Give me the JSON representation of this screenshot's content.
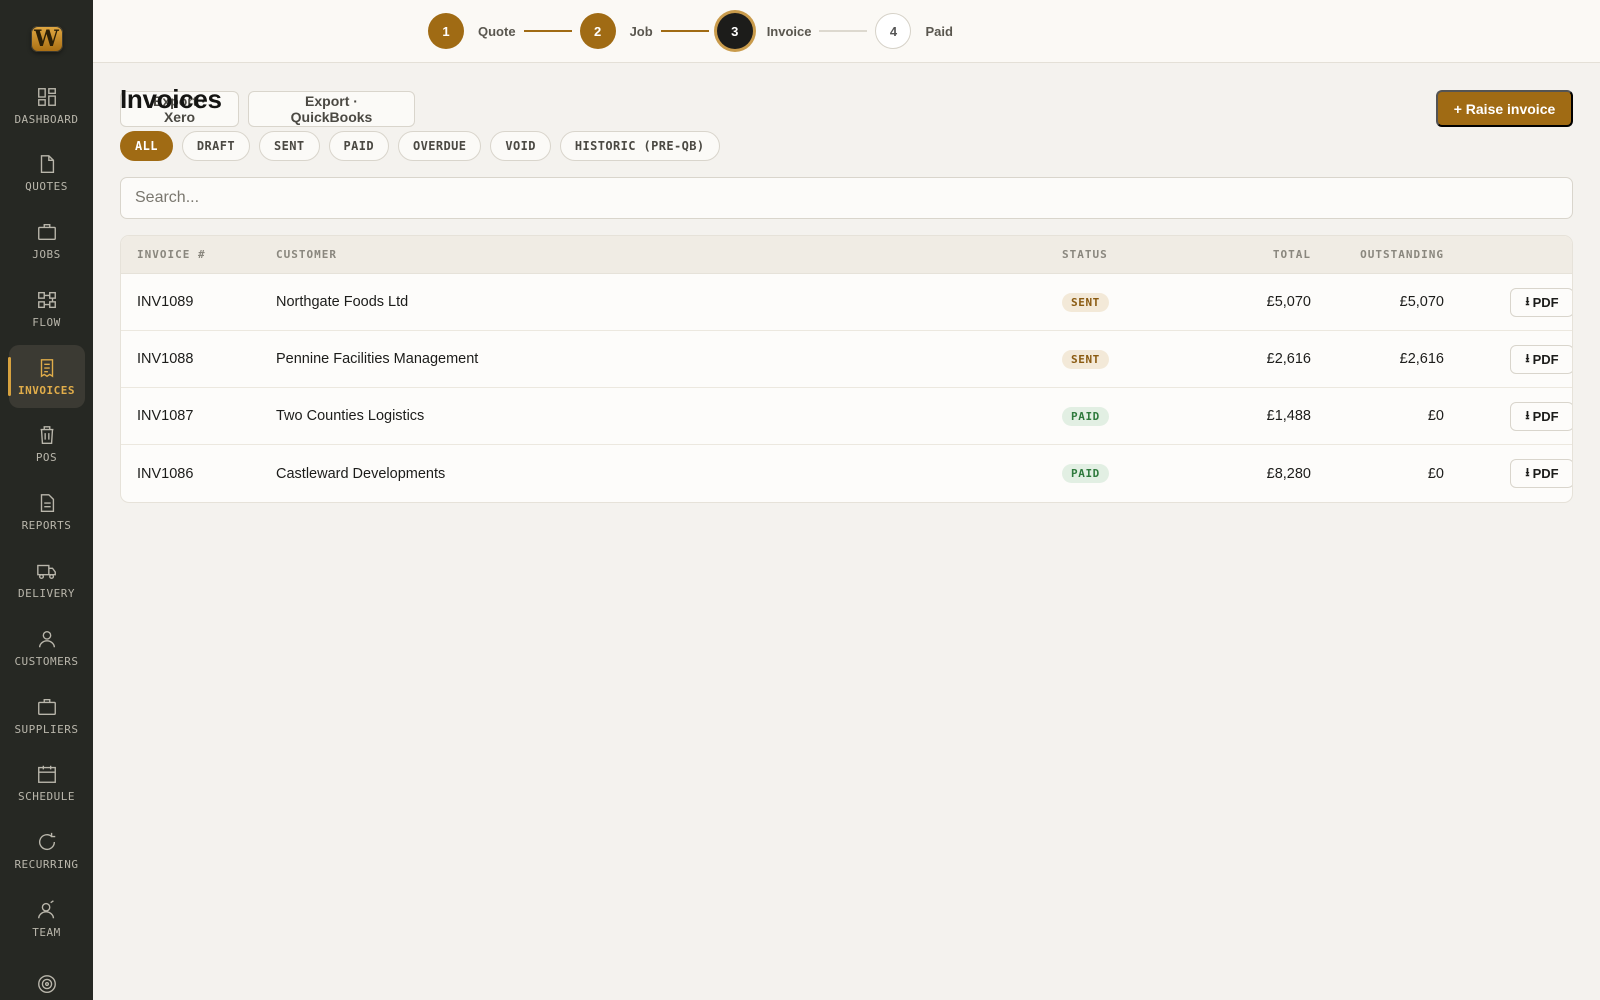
{
  "app": {
    "logo_text": "W"
  },
  "sidebar": {
    "items": [
      {
        "id": "dashboard",
        "label": "DASHBOARD",
        "icon": "grid-icon",
        "active": false
      },
      {
        "id": "quotes",
        "label": "QUOTES",
        "icon": "document-icon",
        "active": false
      },
      {
        "id": "jobs",
        "label": "JOBS",
        "icon": "briefcase-icon",
        "active": false
      },
      {
        "id": "flow",
        "label": "FLOW",
        "icon": "flow-icon",
        "active": false
      },
      {
        "id": "invoices",
        "label": "INVOICES",
        "icon": "receipt-icon",
        "active": true
      },
      {
        "id": "pos",
        "label": "POS",
        "icon": "bin-icon",
        "active": false
      },
      {
        "id": "reports",
        "label": "REPORTS",
        "icon": "report-icon",
        "active": false
      },
      {
        "id": "delivery",
        "label": "DELIVERY",
        "icon": "truck-icon",
        "active": false
      },
      {
        "id": "customers",
        "label": "CUSTOMERS",
        "icon": "person-icon",
        "active": false
      },
      {
        "id": "suppliers",
        "label": "SUPPLIERS",
        "icon": "briefcase-icon",
        "active": false
      },
      {
        "id": "schedule",
        "label": "SCHEDULE",
        "icon": "calendar-icon",
        "active": false
      },
      {
        "id": "recurring",
        "label": "RECURRING",
        "icon": "refresh-icon",
        "active": false
      },
      {
        "id": "team",
        "label": "TEAM",
        "icon": "team-icon",
        "active": false
      },
      {
        "id": "target",
        "label": "",
        "icon": "target-icon",
        "active": false
      }
    ]
  },
  "stepper": {
    "steps": [
      {
        "number": "1",
        "label": "Quote",
        "state": "done"
      },
      {
        "number": "2",
        "label": "Job",
        "state": "done"
      },
      {
        "number": "3",
        "label": "Invoice",
        "state": "current"
      },
      {
        "number": "4",
        "label": "Paid",
        "state": "todo"
      }
    ]
  },
  "header": {
    "title": "Invoices",
    "export_xero": "Export · Xero",
    "export_quickbooks": "Export · QuickBooks",
    "raise_invoice": "+ Raise invoice"
  },
  "filters": [
    "ALL",
    "DRAFT",
    "SENT",
    "PAID",
    "OVERDUE",
    "VOID",
    "HISTORIC (PRE-QB)"
  ],
  "active_filter": "ALL",
  "search": {
    "placeholder": "Search...",
    "value": ""
  },
  "table": {
    "columns": {
      "invoice": "INVOICE #",
      "customer": "CUSTOMER",
      "status": "STATUS",
      "total": "TOTAL",
      "outstanding": "OUTSTANDING"
    },
    "pdf_label": "PDF",
    "rows": [
      {
        "invoice": "INV1089",
        "customer": "Northgate Foods Ltd",
        "status": "SENT",
        "total": "£5,070",
        "outstanding": "£5,070"
      },
      {
        "invoice": "INV1088",
        "customer": "Pennine Facilities Management",
        "status": "SENT",
        "total": "£2,616",
        "outstanding": "£2,616"
      },
      {
        "invoice": "INV1087",
        "customer": "Two Counties Logistics",
        "status": "PAID",
        "total": "£1,488",
        "outstanding": "£0"
      },
      {
        "invoice": "INV1086",
        "customer": "Castleward Developments",
        "status": "PAID",
        "total": "£8,280",
        "outstanding": "£0"
      }
    ]
  },
  "colors": {
    "accent": "#a06b14",
    "sidebar_bg": "#262823",
    "sent_badge": "#f3e9d8",
    "paid_badge": "#e2efe3"
  }
}
